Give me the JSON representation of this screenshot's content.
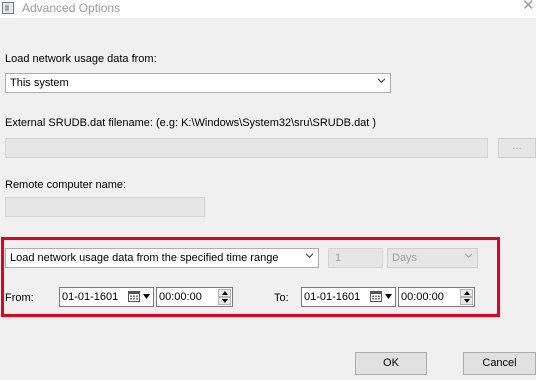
{
  "window": {
    "title": "Advanced Options"
  },
  "source": {
    "label": "Load network usage data from:",
    "selected": "This system"
  },
  "srudb": {
    "label": "External SRUDB.dat filename: (e.g: K:\\Windows\\System32\\sru\\SRUDB.dat )",
    "value": "",
    "browse_label": "..."
  },
  "remote": {
    "label": "Remote computer name:",
    "value": ""
  },
  "time_range": {
    "mode_selected": "Load network usage data from the specified time range",
    "count_value": "1",
    "unit_selected": "Days",
    "from_label": "From:",
    "from_date": "01-01-1601",
    "from_time": "00:00:00",
    "to_label": "To:",
    "to_date": "01-01-1601",
    "to_time": "00:00:00"
  },
  "footer": {
    "ok_label": "OK",
    "cancel_label": "Cancel"
  },
  "colors": {
    "highlight": "#e6001a",
    "dialog_bg": "#f0f0f0"
  }
}
